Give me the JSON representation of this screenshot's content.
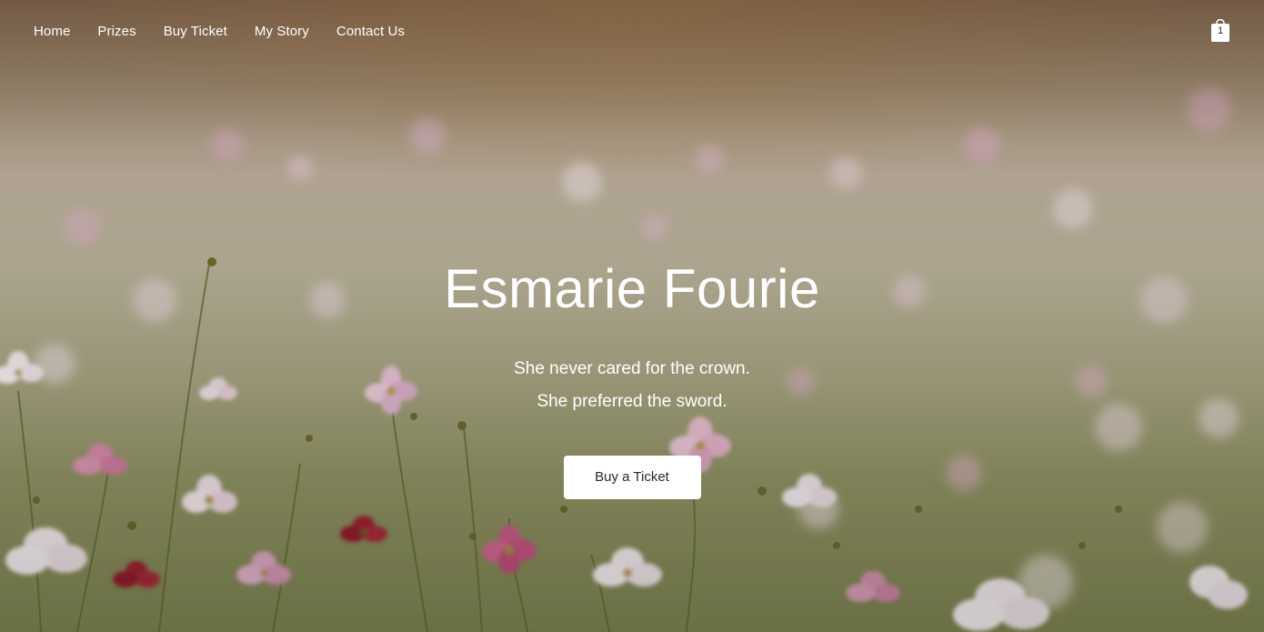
{
  "nav": {
    "items": [
      {
        "label": "Home"
      },
      {
        "label": "Prizes"
      },
      {
        "label": "Buy Ticket"
      },
      {
        "label": "My Story"
      },
      {
        "label": "Contact Us"
      }
    ]
  },
  "cart": {
    "icon": "shopping-bag-icon",
    "count": "1"
  },
  "hero": {
    "title": "Esmarie Fourie",
    "tagline_1": "She never cared for the crown.",
    "tagline_2": "She preferred the sword.",
    "cta_label": "Buy a Ticket",
    "background": "field of pink and white cosmos flowers"
  },
  "colors": {
    "text": "#ffffff",
    "button_bg": "#ffffff",
    "button_text": "#2a2a2a"
  }
}
